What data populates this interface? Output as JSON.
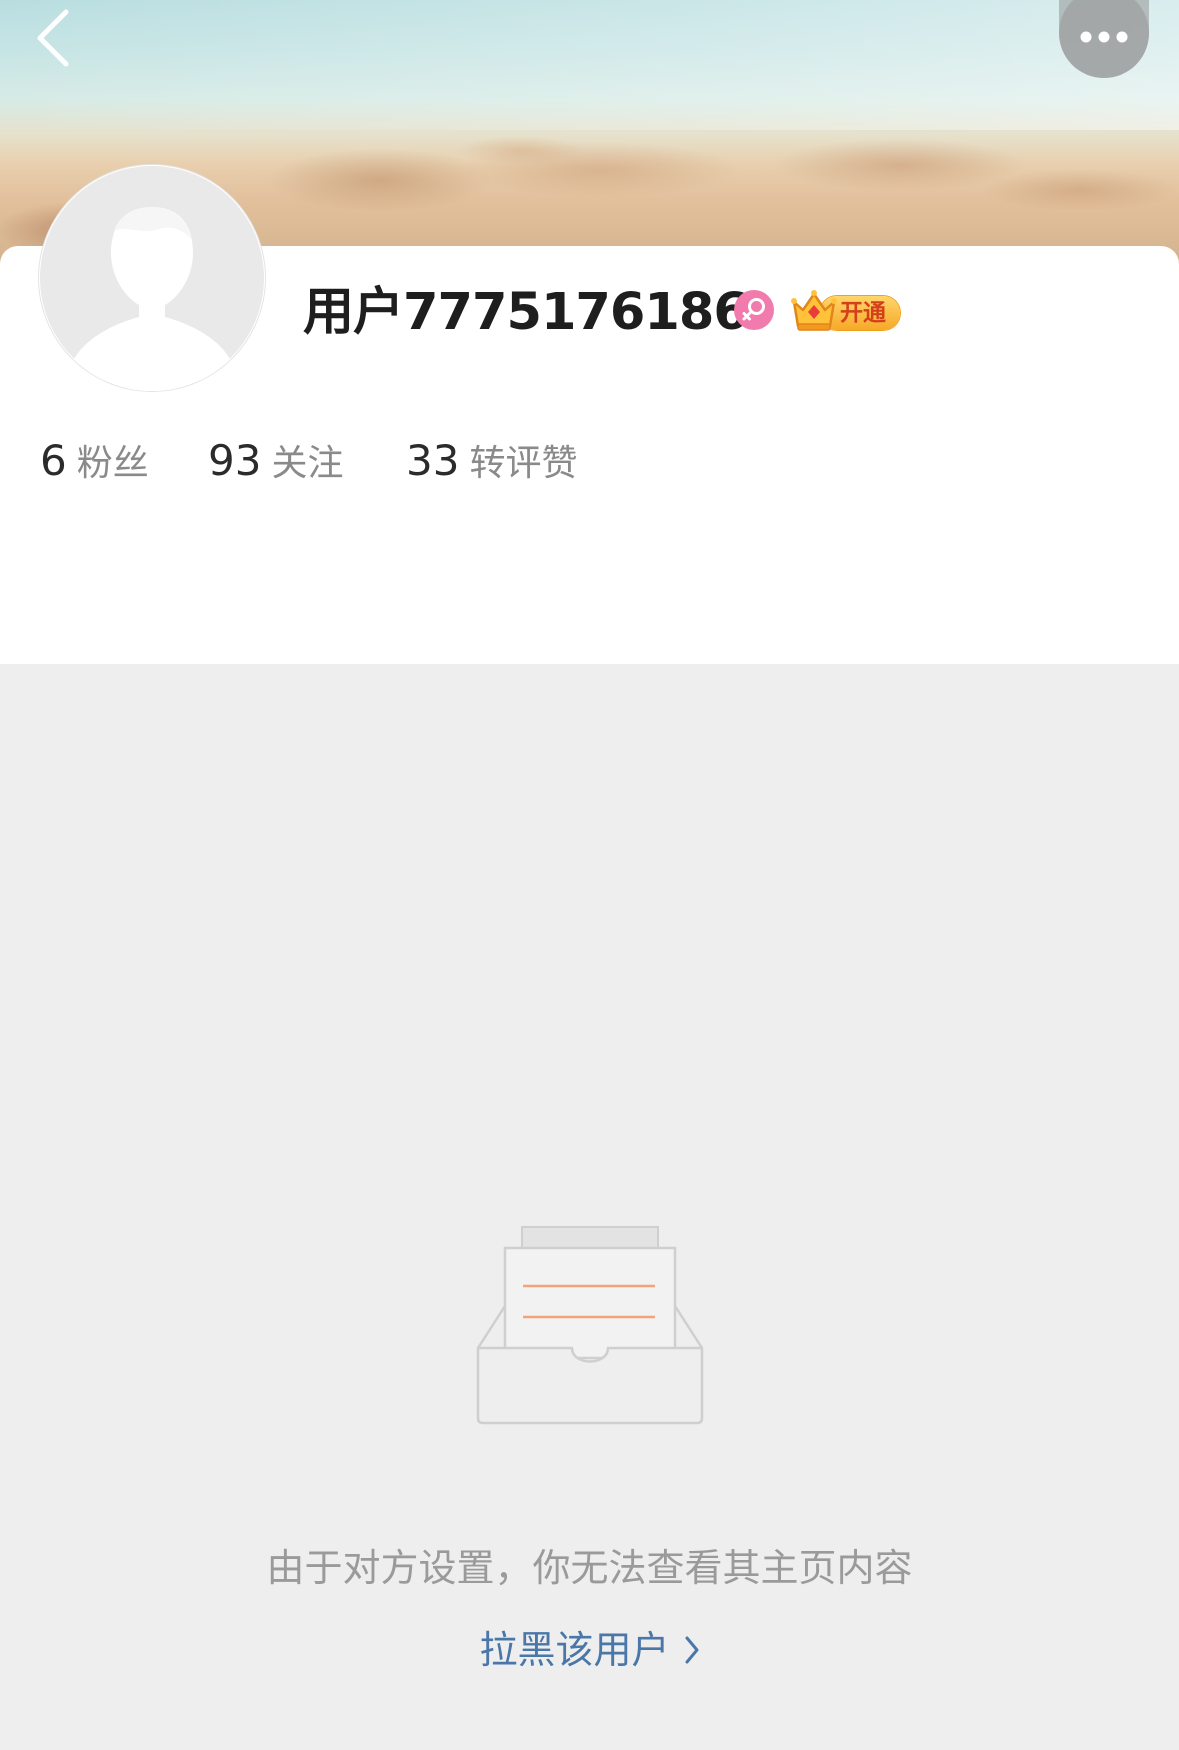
{
  "header": {
    "back_icon": "chevron-left-icon",
    "more_icon": "more-dots-icon"
  },
  "profile": {
    "username": "用户7775176186",
    "gender_icon": "female-icon",
    "gender_color": "#f17bac",
    "vip_label": "开通",
    "vip_icon": "crown-icon",
    "stats": [
      {
        "value": "6",
        "label": "粉丝"
      },
      {
        "value": "93",
        "label": "关注"
      },
      {
        "value": "33",
        "label": "转评赞"
      }
    ]
  },
  "empty_state": {
    "illustration": "empty-inbox-icon",
    "message": "由于对方设置，你无法查看其主页内容",
    "action_label": "拉黑该用户",
    "action_color": "#4a77a8"
  },
  "colors": {
    "page_background": "#eeeeee",
    "card_background": "#ffffff",
    "vip_gold": "#f6a928",
    "accent_line": "#f5a17a"
  }
}
